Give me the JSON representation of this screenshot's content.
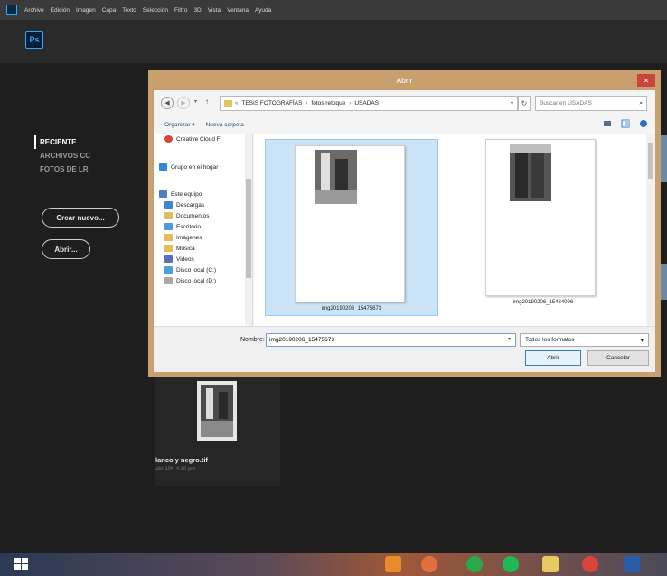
{
  "menubar": {
    "items": [
      "Archivo",
      "Edición",
      "Imagen",
      "Capa",
      "Texto",
      "Selección",
      "Filtro",
      "3D",
      "Vista",
      "Ventana",
      "Ayuda"
    ]
  },
  "app": {
    "logo": "Ps"
  },
  "left_nav": {
    "items": [
      "RECIENTE",
      "ARCHIVOS CC",
      "FOTOS DE LR"
    ],
    "create_button": "Crear nuevo...",
    "open_button": "Abrir..."
  },
  "recent": {
    "file_name": "lanco y negro.tif",
    "file_date": "abr 10ª, 4:30 pm"
  },
  "dialog": {
    "title": "Abrir",
    "close": "✕",
    "breadcrumb": [
      "TESIS FOTOGRAFÍAS",
      "fotos retoque",
      "USADAS"
    ],
    "search_placeholder": "Buscar en USADAS",
    "toolbar": {
      "organize": "Organizar ▾",
      "new_folder": "Nueva carpeta"
    },
    "nav_tree": [
      {
        "label": "Creative Cloud Fi",
        "icon": "creative-cloud-icon",
        "color": "#d9443a"
      },
      {
        "label": "Grupo en el hogar",
        "icon": "homegroup-icon",
        "color": "#2f8ad8"
      },
      {
        "label": "Este equipo",
        "icon": "computer-icon",
        "color": "#4a7fc0"
      },
      {
        "label": "Descargas",
        "icon": "downloads-folder-icon",
        "color": "#3b86d6"
      },
      {
        "label": "Documentos",
        "icon": "documents-folder-icon",
        "color": "#e1be5a"
      },
      {
        "label": "Escritorio",
        "icon": "desktop-folder-icon",
        "color": "#4b9be0"
      },
      {
        "label": "Imágenes",
        "icon": "pictures-folder-icon",
        "color": "#e1be5a"
      },
      {
        "label": "Música",
        "icon": "music-folder-icon",
        "color": "#e1be5a"
      },
      {
        "label": "Videos",
        "icon": "videos-folder-icon",
        "color": "#5a6fc2"
      },
      {
        "label": "Disco local (C:)",
        "icon": "local-disk-icon",
        "color": "#4aa0d8"
      },
      {
        "label": "Disco local (D:)",
        "icon": "local-disk-icon",
        "color": "#a8a8a8"
      }
    ],
    "files": [
      {
        "name": "img20190206_15475673",
        "selected": true
      },
      {
        "name": "img20190206_15484096",
        "selected": false
      }
    ],
    "filename_label": "Nombre:",
    "filename_value": "img20190206_15475673",
    "filetype": "Todos los formatos",
    "open_button": "Abrir",
    "cancel_button": "Cancelar"
  }
}
